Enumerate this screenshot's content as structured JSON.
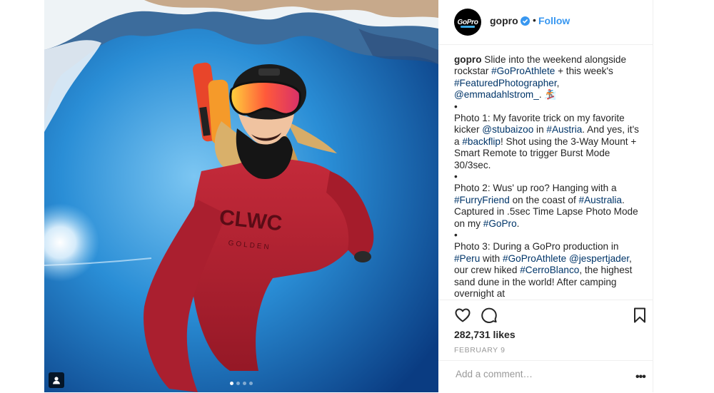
{
  "post": {
    "username": "gopro",
    "follow_label": "Follow",
    "separator": "•",
    "avatar_text": "GoPro",
    "caption": {
      "user": "gopro",
      "intro": " Slide into the weekend alongside rockstar ",
      "tag_athlete": "#GoProAthlete",
      "intro_2": " + this week's ",
      "tag_featured": "#FeaturedPhotographer",
      "comma": ",",
      "mention_emma": "@emmadahlstrom_",
      "intro_end": ". 🏂",
      "bullet": "•",
      "photo1_a": "Photo 1: My favorite trick on my favorite kicker ",
      "mention_stubai": "@stubaizoo",
      "photo1_b": " in ",
      "tag_austria": "#Austria",
      "photo1_c": ". And yes, it's a ",
      "tag_backflip": "#backflip",
      "photo1_d": "! Shot using the 3-Way Mount + Smart Remote to trigger Burst Mode 30/3sec.",
      "photo2_a": "Photo 2: Wus' up roo? Hanging with a ",
      "tag_furry": "#FurryFriend",
      "photo2_b": " on the coast of ",
      "tag_australia": "#Australia",
      "photo2_c": ". Captured in .5sec Time Lapse Photo Mode on my ",
      "tag_gopro": "#GoPro",
      "photo2_d": ".",
      "photo3_a": "Photo 3: During a GoPro production in ",
      "tag_peru": "#Peru",
      "photo3_b": " with ",
      "tag_athlete2": "#GoProAthlete",
      "photo3_c": " ",
      "mention_jesper": "@jespertjader",
      "photo3_d": ", our crew hiked ",
      "tag_cerro": "#CerroBlanco",
      "photo3_e": ", the highest sand dune in the world! After camping overnight at"
    },
    "likes": "282,731 likes",
    "date": "FEBRUARY 9",
    "comment_placeholder": "Add a comment…",
    "more_label": "•••",
    "carousel": {
      "count": 4,
      "active_index": 0
    }
  },
  "colors": {
    "accent": "#3897f0",
    "hashtag": "#003569",
    "sky_top": "#5fb7ee",
    "sky_bottom": "#0b3f86",
    "hoodie": "#b51f2e",
    "goggles": "#f3503b"
  },
  "icons": {
    "heart": "heart-icon",
    "comment": "comment-icon",
    "bookmark": "bookmark-icon",
    "user_tag": "user-tag-icon",
    "verified": "verified-badge-icon"
  }
}
